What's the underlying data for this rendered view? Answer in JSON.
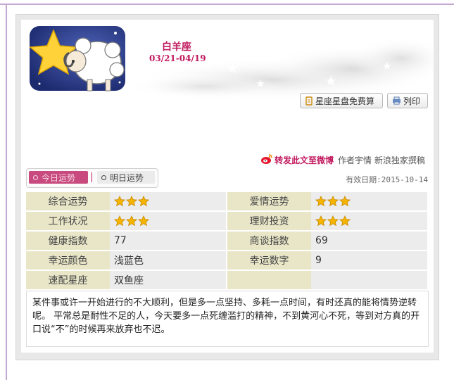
{
  "header": {
    "sign_name": "白羊座",
    "sign_dates": "03/21-04/19",
    "avatar_icon": "ram-with-star-icon"
  },
  "buttons": {
    "horoscope_label": "星座星盘免费算",
    "print_label": "列印"
  },
  "share": {
    "weibo_label": "转发此文至微博",
    "author": "作者宇情 新浪独家撰稿"
  },
  "tabs": [
    {
      "label": "今日运势",
      "active": true
    },
    {
      "label": "明日运势",
      "active": false
    }
  ],
  "valid_date": "有效日期:2015-10-14",
  "fortune": [
    {
      "label": "综合运势",
      "stars": 3,
      "label2": "爱情运势",
      "stars2": 3
    },
    {
      "label": "工作状况",
      "stars": 3,
      "label2": "理财投资",
      "stars2": 3
    },
    {
      "label": "健康指数",
      "value": "77",
      "label2": "商谈指数",
      "value2": "69"
    },
    {
      "label": "幸运颜色",
      "value": "浅蓝色",
      "label2": "幸运数字",
      "value2": "9"
    },
    {
      "label": "速配星座",
      "value": "双鱼座",
      "label2": "",
      "value2": ""
    }
  ],
  "description": "某件事或许一开始进行的不大顺利，但是多一点坚持、多耗一点时间，有时还真的能将情势逆转呢。 平常总是耐性不足的人，今天要多一点死缠滥打的精神，不到黄河心不死，等到对方真的开口说“不”的时候再来放弃也不迟。",
  "colors": {
    "accent": "#c0185e",
    "frame": "#c4a8d0",
    "label_bg": "#e9e6c8",
    "star": "#f5b400"
  }
}
